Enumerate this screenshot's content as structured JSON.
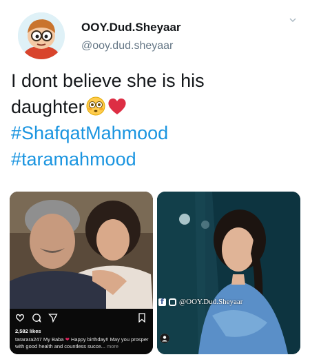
{
  "tweet": {
    "display_name": "OOY.Dud.Sheyaar",
    "handle": "@ooy.dud.sheyaar",
    "text_line_1": "I dont believe she is his",
    "text_line_2": "daughter",
    "hashtag_1": "#ShafqatMahmood",
    "hashtag_2": "#taramahmood",
    "emojis": [
      "flushed-face",
      "red-heart"
    ]
  },
  "media": {
    "instagram": {
      "likes": "2,582 likes",
      "caption_user": "tararara247",
      "caption_text": "My Baba",
      "caption_rest": "Happy birthday!! May you prosper with good health and countless succe...",
      "caption_more": "more"
    },
    "watermark": "@OOY.Dud.Sheyaar"
  },
  "colors": {
    "hashtag": "#1b95e0",
    "handle": "#657786",
    "text": "#14171a"
  }
}
